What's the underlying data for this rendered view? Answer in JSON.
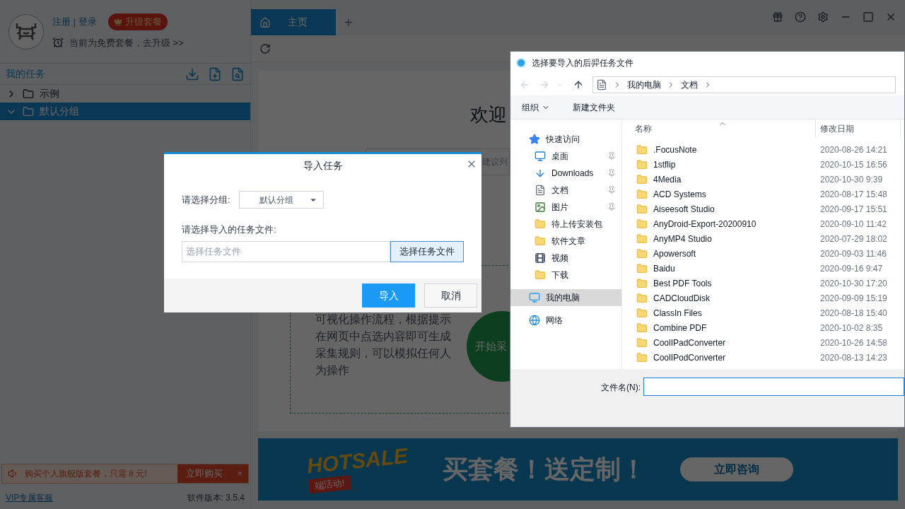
{
  "sidebar": {
    "auth_links": "注册 | 登录",
    "upgrade_badge": "升级套餐",
    "plan_notice": "当前为免费套餐，去升级 >>",
    "section_title": "我的任务",
    "tree": [
      {
        "label": "示例",
        "expanded": false,
        "selected": false
      },
      {
        "label": "默认分组",
        "expanded": true,
        "selected": true
      }
    ],
    "promo": {
      "text": "购买个人旗舰版套餐，只需 8 元!",
      "button": "立即购买",
      "close": "×"
    },
    "support_link": "VIP专属客服",
    "version": "软件版本: 3.5.4"
  },
  "tabs": [
    {
      "label": "主页",
      "selected": true
    }
  ],
  "new_tab": "+",
  "main": {
    "welcome": "欢迎",
    "search_fragment": "建议列",
    "card_text": "可视化操作流程，根据提示在网页中点选内容即可生成采集规则，可以模拟任何人为操作",
    "start_button": "开始采",
    "banner": {
      "logo": "HOTSALE",
      "logo_ribbon": "端活动!",
      "headline": "买套餐！送定制！",
      "button": "立即咨询"
    }
  },
  "import_dialog": {
    "title": "导入任务",
    "group_label": "请选择分组:",
    "group_value": "默认分组",
    "file_label": "请选择导入的任务文件:",
    "file_placeholder": "选择任务文件",
    "browse_button": "选择任务文件",
    "ok": "导入",
    "cancel": "取消"
  },
  "file_dialog": {
    "title": "选择要导入的后羿任务文件",
    "path": [
      "我的电脑",
      "文档"
    ],
    "organize": "组织",
    "new_folder": "新建文件夹",
    "nav": [
      {
        "label": "快速访问",
        "kind": "star",
        "pinned": false,
        "selected": false
      },
      {
        "label": "桌面",
        "kind": "desktop",
        "pinned": true,
        "selected": false
      },
      {
        "label": "Downloads",
        "kind": "download",
        "pinned": true,
        "selected": false
      },
      {
        "label": "文档",
        "kind": "document",
        "pinned": true,
        "selected": false
      },
      {
        "label": "图片",
        "kind": "image",
        "pinned": true,
        "selected": false
      },
      {
        "label": "待上传安装包",
        "kind": "folder",
        "pinned": false,
        "selected": false
      },
      {
        "label": "软件文章",
        "kind": "folder",
        "pinned": false,
        "selected": false
      },
      {
        "label": "视频",
        "kind": "video",
        "pinned": false,
        "selected": false
      },
      {
        "label": "下载",
        "kind": "folder",
        "pinned": false,
        "selected": false
      },
      {
        "label": "我的电脑",
        "kind": "pc",
        "pinned": false,
        "selected": true
      },
      {
        "label": "网络",
        "kind": "network",
        "pinned": false,
        "selected": false
      }
    ],
    "columns": [
      "名称",
      "修改日期"
    ],
    "rows": [
      {
        "name": ".FocusNote",
        "date": "2020-08-26 14:21"
      },
      {
        "name": "1stflip",
        "date": "2020-10-15 16:56"
      },
      {
        "name": "4Media",
        "date": "2020-10-30 9:39"
      },
      {
        "name": "ACD Systems",
        "date": "2020-08-17 15:48"
      },
      {
        "name": "Aiseesoft Studio",
        "date": "2020-09-17 15:51"
      },
      {
        "name": "AnyDroid-Export-20200910",
        "date": "2020-09-10 11:42"
      },
      {
        "name": "AnyMP4 Studio",
        "date": "2020-07-29 18:02"
      },
      {
        "name": "Apowersoft",
        "date": "2020-09-03 11:46"
      },
      {
        "name": "Baidu",
        "date": "2020-09-16 9:47"
      },
      {
        "name": "Best PDF Tools",
        "date": "2020-10-30 17:20"
      },
      {
        "name": "CADCloudDisk",
        "date": "2020-09-09 15:19"
      },
      {
        "name": "ClassIn Files",
        "date": "2020-08-18 15:40"
      },
      {
        "name": "Combine PDF",
        "date": "2020-10-02 8:35"
      },
      {
        "name": "CoolIPadConverter",
        "date": "2020-10-26 14:58"
      },
      {
        "name": "CoolIPodConverter",
        "date": "2020-08-13 14:23"
      }
    ],
    "filename_label": "文件名(N):"
  }
}
